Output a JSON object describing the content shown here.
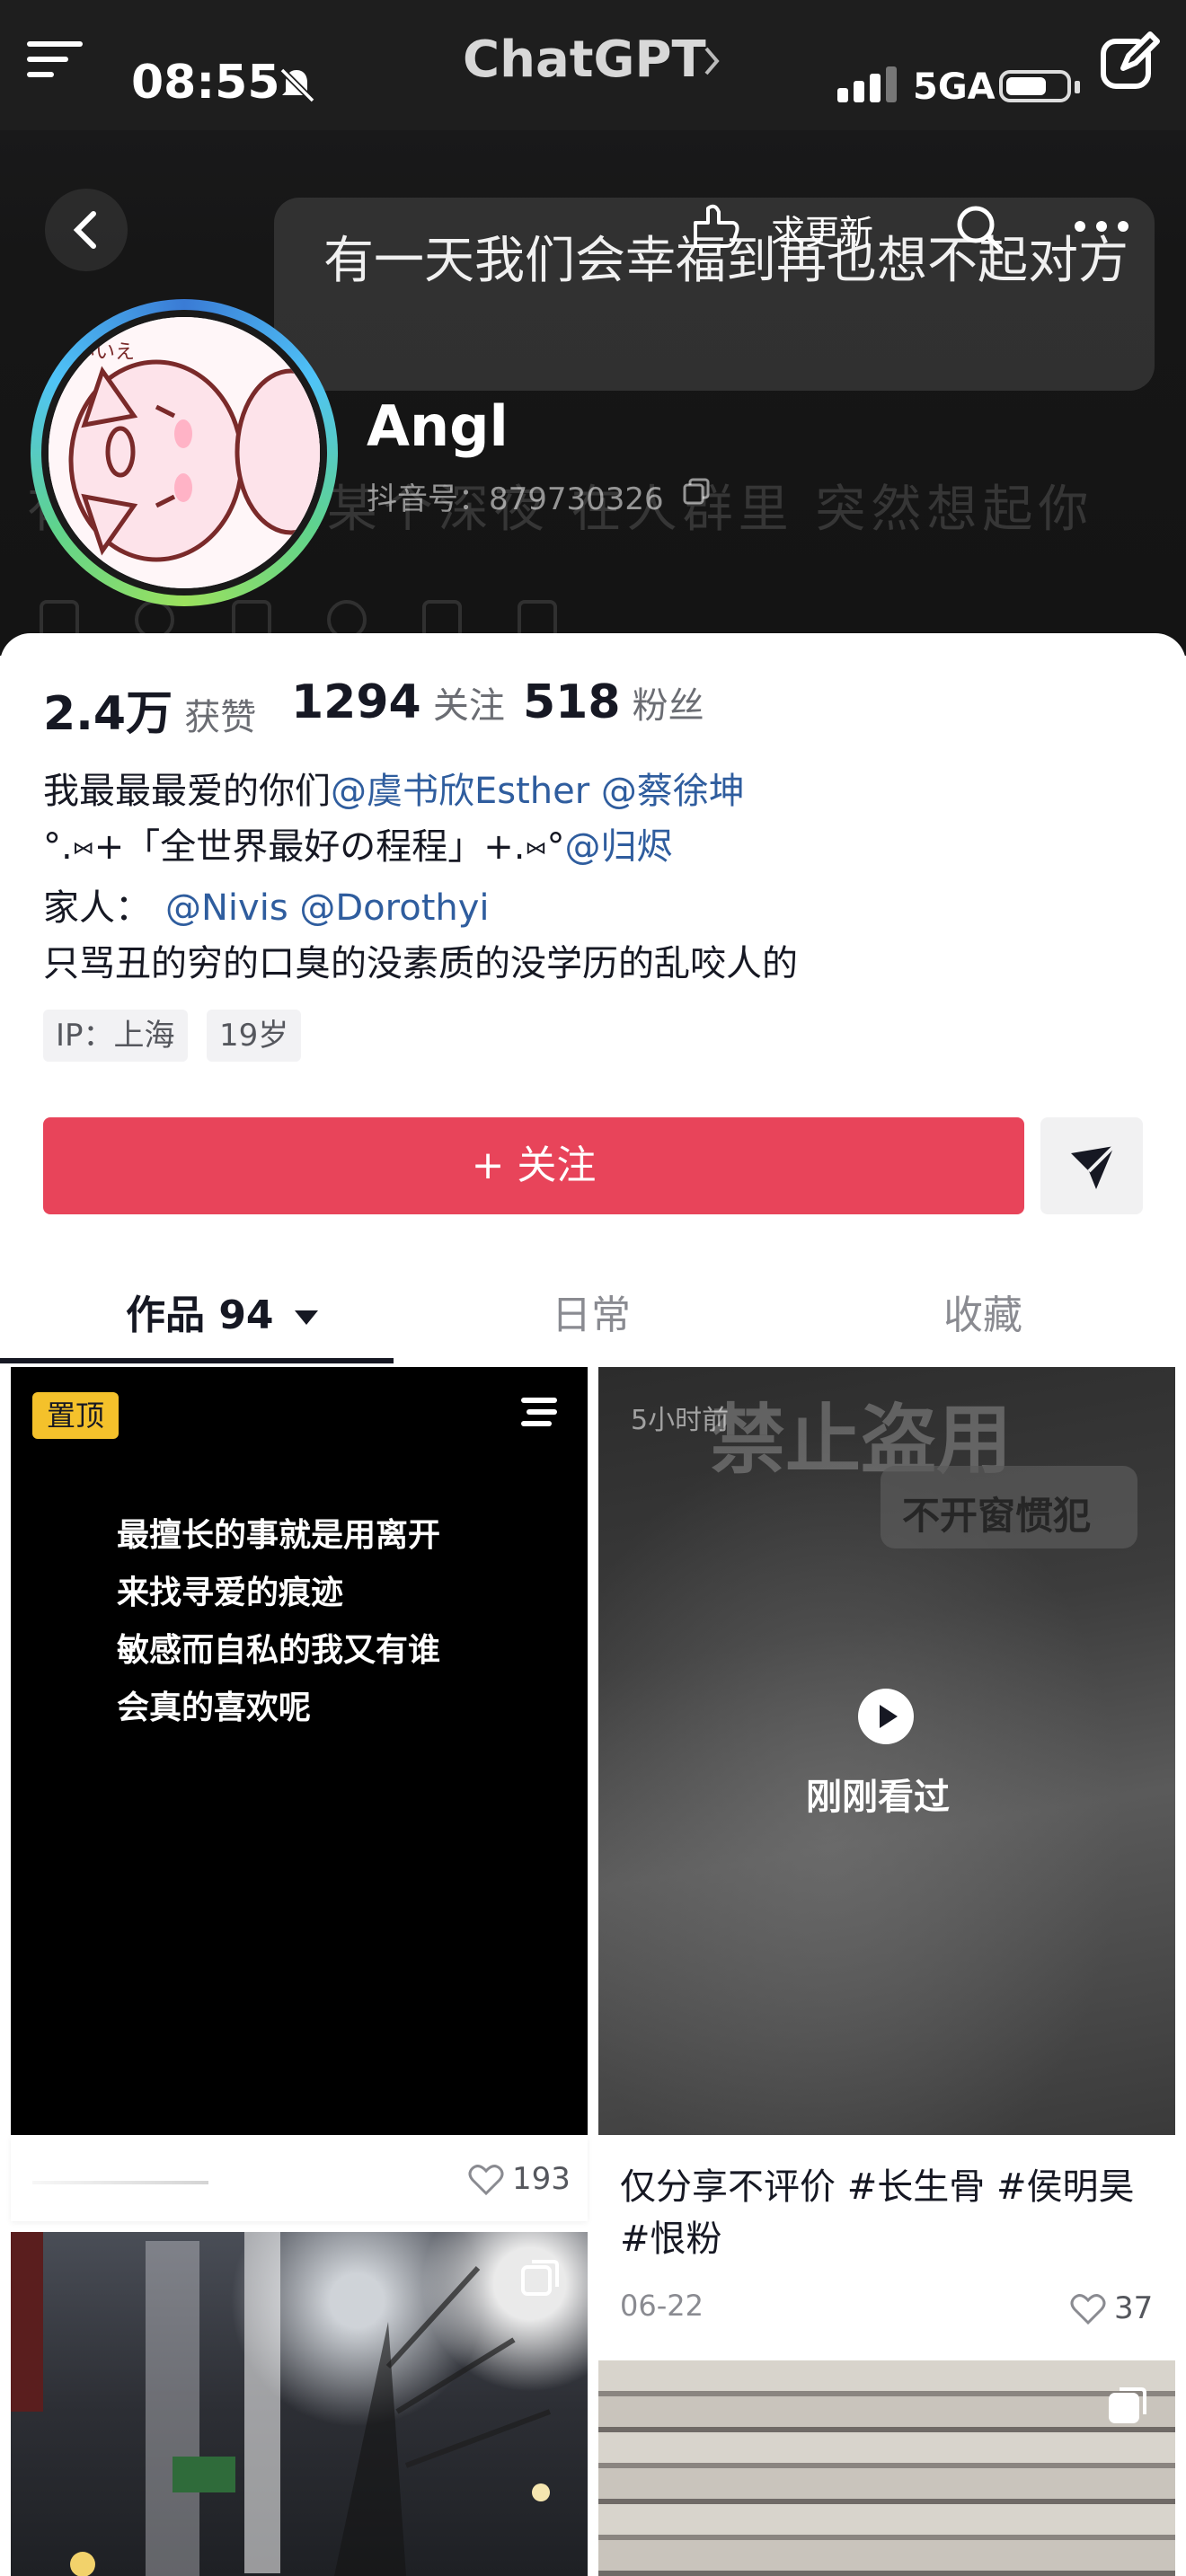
{
  "status_bar": {
    "time": "08:55",
    "app_title": "ChatGPT",
    "network": "5GA"
  },
  "header": {
    "banner_text": "有一天我们会幸福到再也想不起对方",
    "request_update": "求更新",
    "ghost_text": "有一瞬间 在某个深夜 在人群里 突然想起你"
  },
  "profile": {
    "name": "Angl",
    "douyin_id": "抖音号：879730326"
  },
  "stats": [
    {
      "value": "2.4万",
      "label": "获赞"
    },
    {
      "value": "1294",
      "label": "关注"
    },
    {
      "value": "518",
      "label": "粉丝"
    }
  ],
  "bio": {
    "line1_text": "我最最最爱的你们",
    "line1_mentions": "@虞书欣Esther @蔡徐坤",
    "line2_text": "°.⑅+「全世界最好の程程」+.⑅°",
    "line2_mention": "@归烬",
    "line3_text": "家人：",
    "line3_mentions": "@Nivis @Dorothyi",
    "line4_text": "只骂丑的穷的口臭的没素质的没学历的乱咬人的"
  },
  "tags": {
    "ip": "IP：上海",
    "age": "19岁"
  },
  "actions": {
    "follow": "+ 关注"
  },
  "tabs": [
    {
      "label": "作品 94",
      "active": true
    },
    {
      "label": "日常",
      "active": false
    },
    {
      "label": "收藏",
      "active": false
    }
  ],
  "posts": [
    {
      "pinned_label": "置顶",
      "lines": [
        "最擅长的事就是用离开",
        "来找寻爱的痕迹",
        "敏感而自私的我又有谁",
        "会真的喜欢呢"
      ],
      "likes": "193"
    },
    {
      "watermark": "禁止盗用",
      "time_ago": "5小时前",
      "tag": "不开窗惯犯",
      "overlay": "刚刚看过",
      "caption": "仅分享不评价 #长生骨 #侯明昊 #恨粉",
      "date": "06-22",
      "likes": "37"
    }
  ],
  "colors": {
    "follow_button": "#e8445a",
    "mention": "#2f5d9e",
    "pinned_badge": "#f4c12b"
  }
}
